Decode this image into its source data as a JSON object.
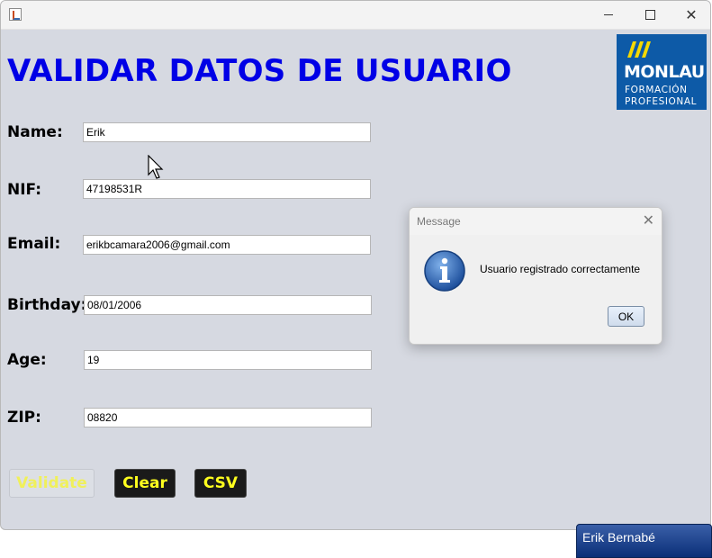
{
  "window": {
    "minimize": "minimize",
    "maximize": "maximize",
    "close": "close"
  },
  "heading": "VALIDAR DATOS DE USUARIO",
  "logo": {
    "name": "MONLAU",
    "line1": "FORMACIÓN",
    "line2": "PROFESIONAL",
    "color": "#0d5aa7"
  },
  "form": {
    "name": {
      "label": "Name:",
      "value": "Erik"
    },
    "nif": {
      "label": "NIF:",
      "value": "47198531R"
    },
    "email": {
      "label": "Email:",
      "value": "erikbcamara2006@gmail.com"
    },
    "birthday": {
      "label": "Birthday:",
      "value": "08/01/2006"
    },
    "age": {
      "label": "Age:",
      "value": "19"
    },
    "zip": {
      "label": "ZIP:",
      "value": "08820"
    }
  },
  "buttons": {
    "validate": "Validate",
    "clear": "Clear",
    "csv": "CSV"
  },
  "dialog": {
    "title": "Message",
    "message": "Usuario registrado correctamente",
    "ok": "OK",
    "icon": "info-icon"
  },
  "taskbar": {
    "user_name": "Erik Bernabé"
  },
  "colors": {
    "heading": "#0000e6",
    "button_text": "#ffff1e",
    "background": "#d6d9e1"
  }
}
